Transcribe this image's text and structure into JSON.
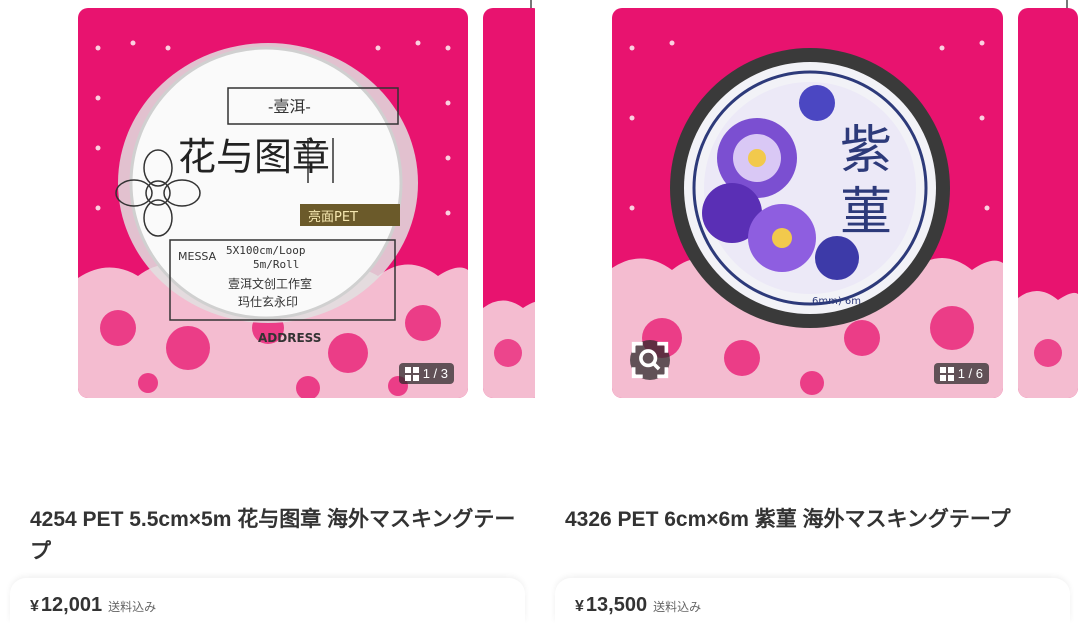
{
  "products": [
    {
      "title": "4254 PET 5.5cm×5m 花与图章 海外マスキングテープ",
      "price_symbol": "¥",
      "price": "12,001",
      "shipping": "送料込み",
      "page_indicator": "1 / 3",
      "tape": {
        "brand": "-壹洱-",
        "name": "花与图章",
        "finish_badge": "亮面PET",
        "spec_line1": "5X100cm/Loop",
        "spec_line2": "5m/Roll",
        "maker": "壹洱文创工作室",
        "seal": "玛仕玄永印",
        "message_label": "MESSA",
        "address_label": "ADDRESS"
      }
    },
    {
      "title": "4326 PET 6cm×6m 紫菫 海外マスキングテープ",
      "price_symbol": "¥",
      "price": "13,500",
      "shipping": "送料込み",
      "page_indicator": "1 / 6",
      "tape": {
        "name_char1": "紫",
        "name_char2": "菫",
        "rim_text": "6mm) 6m"
      }
    }
  ],
  "colors": {
    "backdrop_pink": "#e8136f",
    "lace": "#f4bcd0",
    "violet": "#6a3fc4"
  }
}
